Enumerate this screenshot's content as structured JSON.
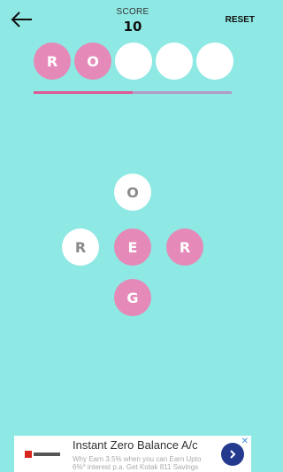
{
  "header": {
    "score_label": "SCORE",
    "score_value": "10",
    "reset_label": "RESET",
    "back_icon": "arrow-left-icon"
  },
  "answer_slots": [
    "R",
    "O",
    "",
    "",
    ""
  ],
  "progress": {
    "value": 0.5
  },
  "tiles": {
    "top": "O",
    "left": "R",
    "center": "E",
    "right": "R",
    "bottom": "G"
  },
  "colors": {
    "background": "#8ee8e3",
    "pink": "#e58ab8",
    "progress": "#e05893"
  },
  "ad": {
    "title": "Instant Zero Balance A/c",
    "text": "Why Earn 3.5% when you can Earn Upto 6%* interest p.a. Get Kotak 811 Savings",
    "logo": "kotak",
    "close": "✕"
  }
}
